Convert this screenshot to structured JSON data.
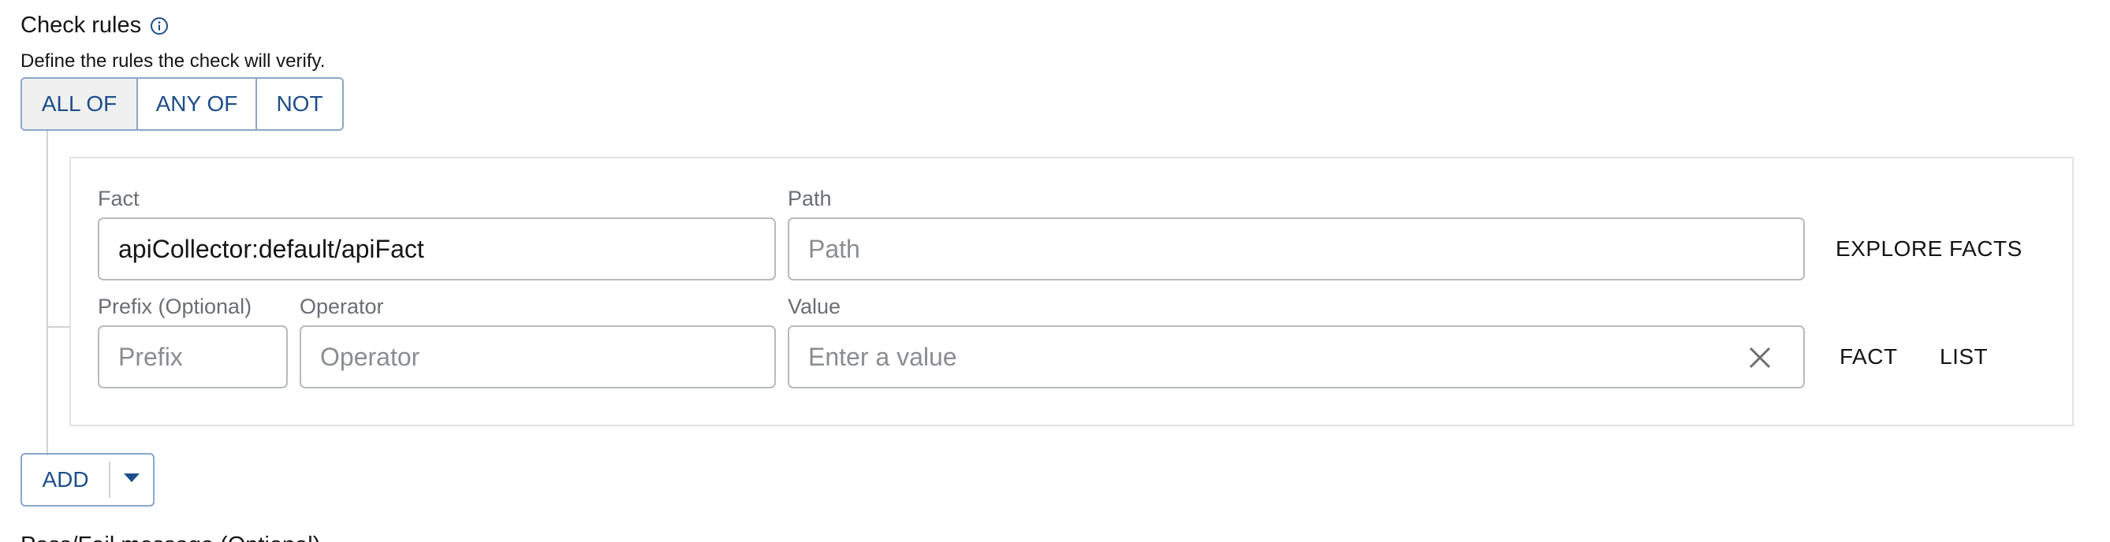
{
  "section": {
    "title": "Check rules",
    "description": "Define the rules the check will verify."
  },
  "toggle": {
    "all_of": "ALL OF",
    "any_of": "ANY OF",
    "not": "NOT"
  },
  "rule": {
    "fact_label": "Fact",
    "fact_value": "apiCollector:default/apiFact",
    "path_label": "Path",
    "path_placeholder": "Path",
    "explore_facts": "EXPLORE FACTS",
    "prefix_label": "Prefix (Optional)",
    "prefix_placeholder": "Prefix",
    "operator_label": "Operator",
    "operator_placeholder": "Operator",
    "value_label": "Value",
    "value_placeholder": "Enter a value",
    "fact_button": "FACT",
    "list_button": "LIST"
  },
  "add_button": {
    "label": "ADD"
  },
  "next_section": {
    "title_partial": "Pass/Fail message (Optional)"
  },
  "colors": {
    "accent": "#1d4e89",
    "border": "#8aa7c9",
    "placeholder": "#8a8d90",
    "label": "#6a6e73"
  }
}
